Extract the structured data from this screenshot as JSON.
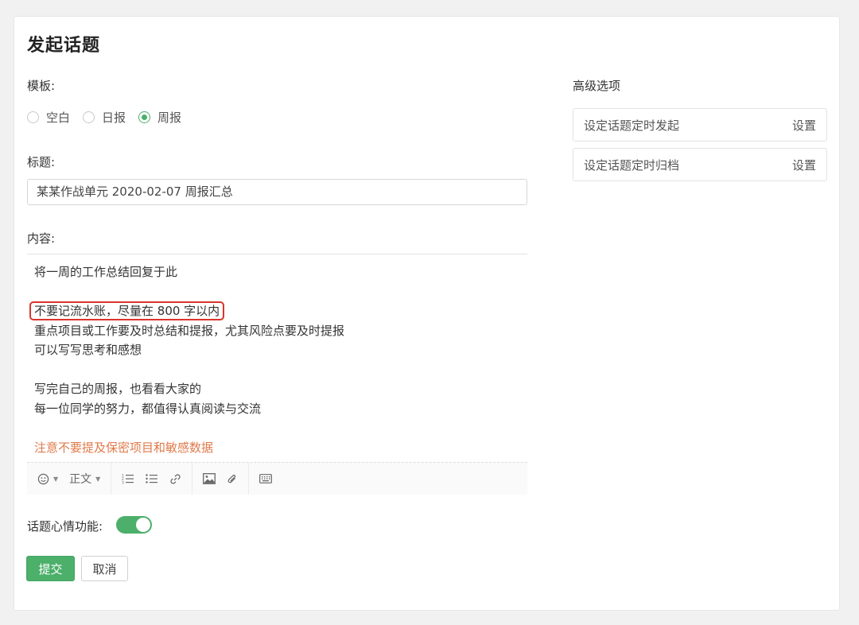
{
  "page": {
    "title": "发起话题"
  },
  "template": {
    "label": "模板:",
    "options": [
      {
        "label": "空白",
        "checked": false
      },
      {
        "label": "日报",
        "checked": false
      },
      {
        "label": "周报",
        "checked": true
      }
    ]
  },
  "title_field": {
    "label": "标题:",
    "value": "某某作战单元 2020-02-07 周报汇总"
  },
  "content": {
    "label": "内容:",
    "lines": [
      "将一周的工作总结回复于此",
      "",
      "不要记流水账，尽量在 800 字以内",
      "重点项目或工作要及时总结和提报，尤其风险点要及时提报",
      "可以写写思考和感想",
      "",
      "写完自己的周报，也看看大家的",
      "每一位同学的努力，都值得认真阅读与交流",
      "",
      "注意不要提及保密项目和敏感数据"
    ],
    "warning_color": "#e07a4a",
    "highlight_color": "#d9352b"
  },
  "toolbar": {
    "emoji_icon": "smile-icon",
    "format_label": "正文",
    "icons": [
      "ordered-list-icon",
      "unordered-list-icon",
      "link-icon",
      "image-icon",
      "attachment-icon",
      "keyboard-icon"
    ]
  },
  "mood": {
    "label": "话题心情功能:",
    "enabled": true
  },
  "actions": {
    "submit": "提交",
    "cancel": "取消"
  },
  "advanced": {
    "title": "高级选项",
    "rows": [
      {
        "label": "设定话题定时发起",
        "action": "设置"
      },
      {
        "label": "设定话题定时归档",
        "action": "设置"
      }
    ]
  },
  "colors": {
    "accent": "#4caf6a"
  }
}
